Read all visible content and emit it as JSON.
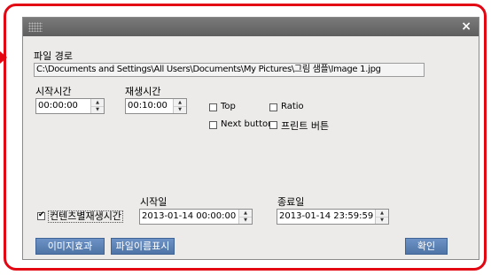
{
  "dialog": {
    "close_glyph": "×",
    "file_path_label": "파일 경로",
    "file_path_value": "C:\\Documents and Settings\\All Users\\Documents\\My Pictures\\그림 샘플\\Image 1.jpg",
    "start_time": {
      "label": "시작시간",
      "value": "00:00:00"
    },
    "play_time": {
      "label": "재생시간",
      "value": "00:10:00"
    },
    "options": {
      "top": {
        "label": "Top",
        "checked": false
      },
      "ratio": {
        "label": "Ratio",
        "checked": false
      },
      "next_button": {
        "label": "Next button",
        "checked": false
      },
      "print_button": {
        "label": "프린트 버튼",
        "checked": false
      }
    },
    "content_play_time": {
      "label": "컨텐츠별재생시간",
      "checked": true
    },
    "start_date": {
      "label": "시작일",
      "value": "2013-01-14 00:00:00"
    },
    "end_date": {
      "label": "종료일",
      "value": "2013-01-14 23:59:59"
    },
    "buttons": {
      "image_effect": "이미지효과",
      "show_filename": "파일이름표시",
      "ok": "확인"
    }
  },
  "colors": {
    "highlight_border": "#e30613",
    "title_bar": "#6d6d6d",
    "dialog_bg": "#ecebea",
    "button": "#5b82b5"
  }
}
